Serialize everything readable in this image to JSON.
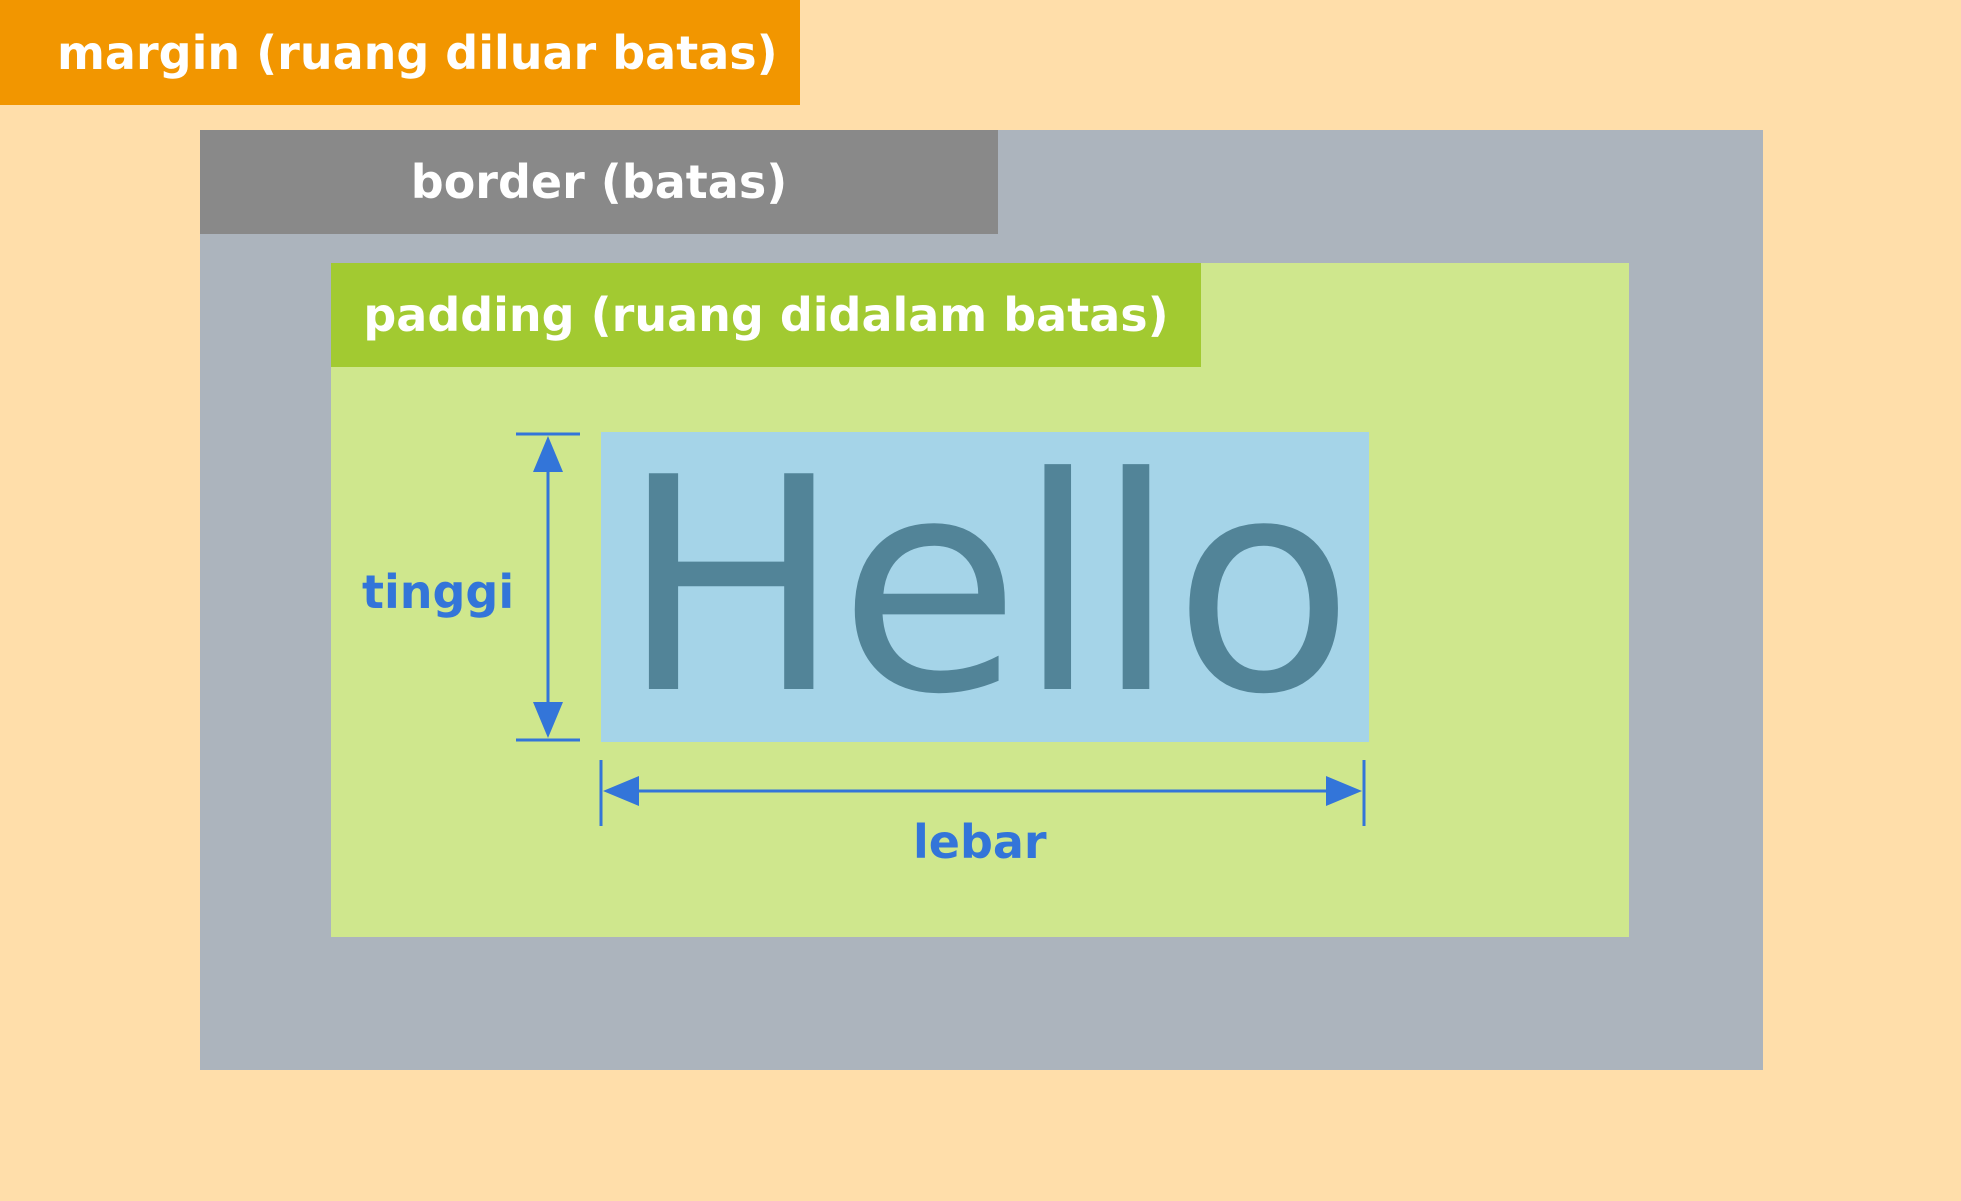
{
  "labels": {
    "margin": "margin (ruang diluar batas)",
    "border": "border (batas)",
    "padding": "padding (ruang didalam batas)",
    "content": "Hello",
    "height": "tinggi",
    "width": "lebar"
  },
  "colors": {
    "margin_bg": "#FFDEAA",
    "margin_label_bg": "#F29600",
    "border_bg": "#ACB4BD",
    "border_label_bg": "#898989",
    "padding_bg": "#CFE78D",
    "padding_label_bg": "#A2CA31",
    "content_bg": "#A5D4E8",
    "content_text": "#528498",
    "dimension": "#3375D9"
  }
}
